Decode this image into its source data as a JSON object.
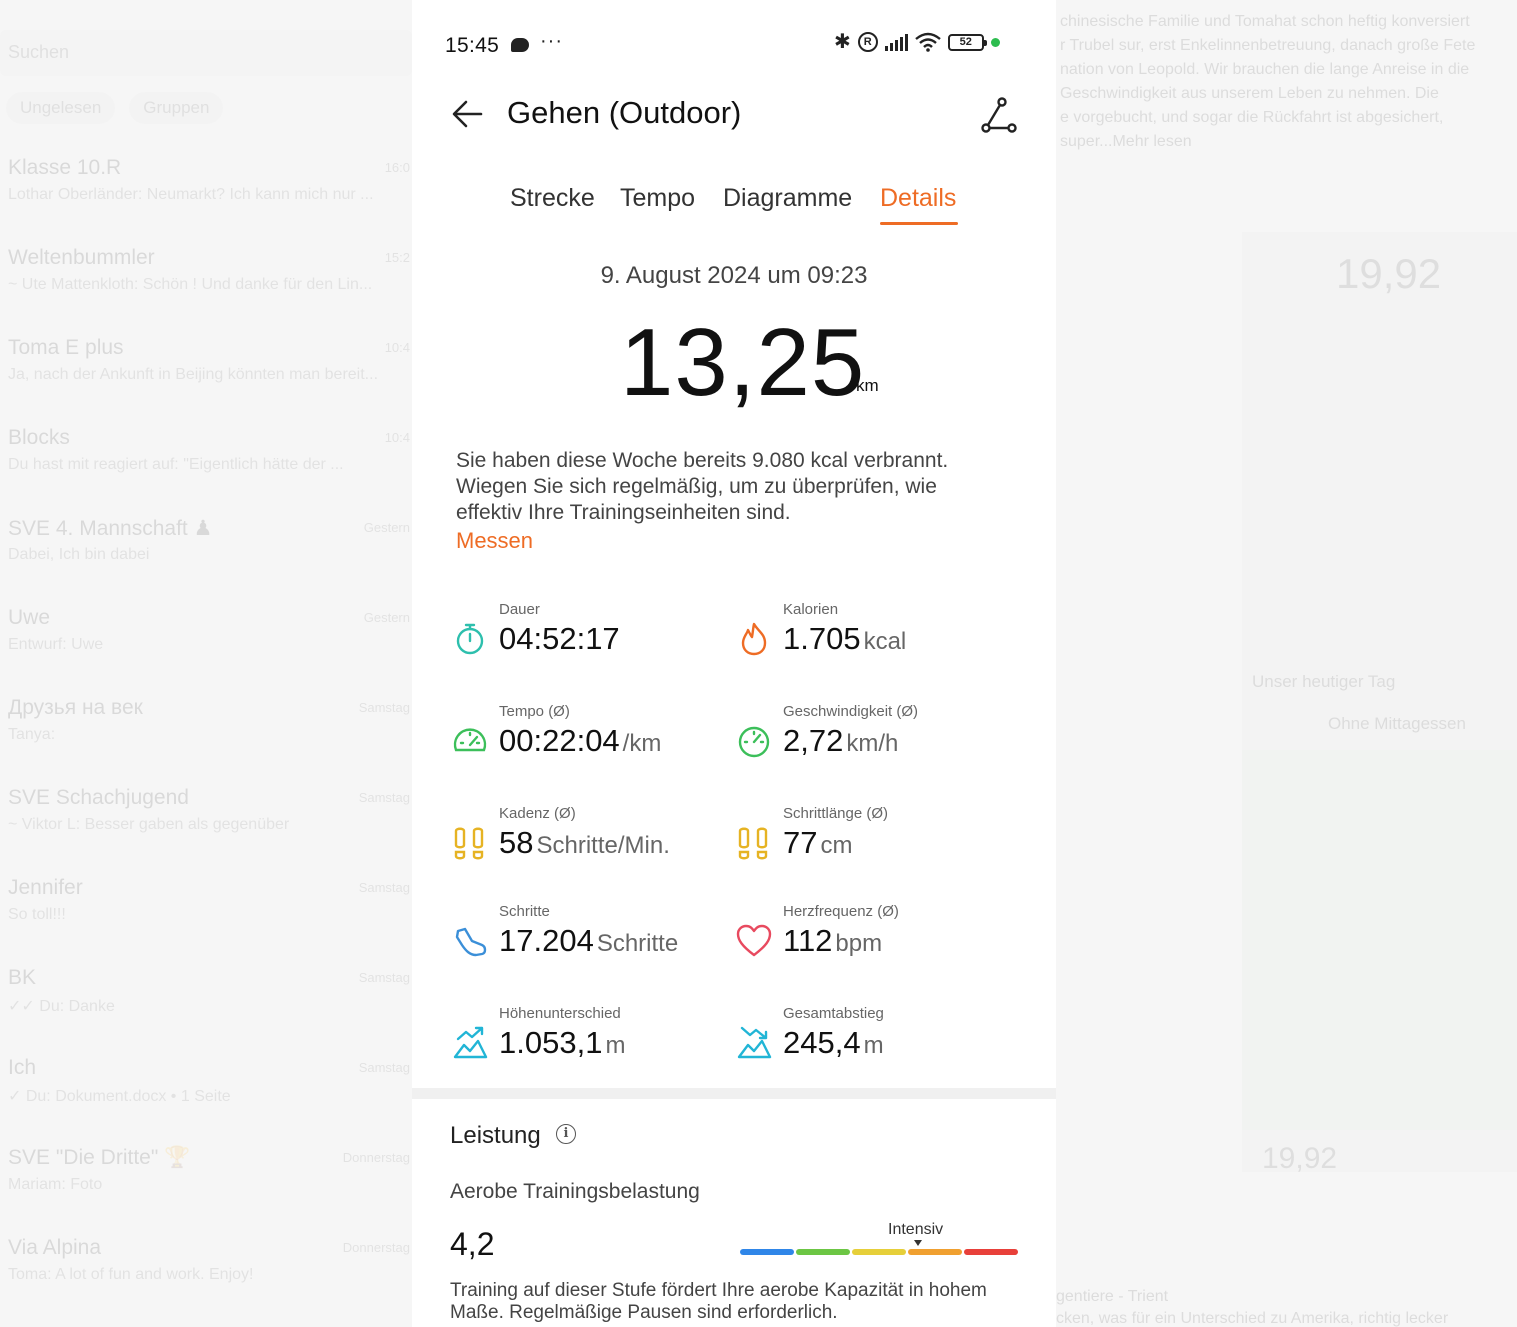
{
  "status_bar": {
    "time": "15:45",
    "dots": "···",
    "battery": "52",
    "icons": [
      "message-icon",
      "bluetooth-icon",
      "registered-icon",
      "signal-icon",
      "wifi-icon",
      "battery-icon",
      "status-dot"
    ]
  },
  "header": {
    "title": "Gehen (Outdoor)",
    "back_icon": "arrow-left-icon",
    "route_icon": "route-icon"
  },
  "tabs": [
    {
      "label": "Strecke",
      "active": false
    },
    {
      "label": "Tempo",
      "active": false
    },
    {
      "label": "Diagramme",
      "active": false
    },
    {
      "label": "Details",
      "active": true
    }
  ],
  "summary": {
    "date": "9. August 2024 um 09:23",
    "distance": "13,25",
    "distance_unit": "km",
    "info_line1": "Sie haben diese Woche bereits 9.080 kcal verbrannt.",
    "info_line2": "Wiegen Sie sich regelmäßig, um zu überprüfen, wie",
    "info_line3": "effektiv Ihre Trainingseinheiten sind.",
    "measure_link": "Messen"
  },
  "metrics": [
    {
      "label": "Dauer",
      "value": "04:52:17",
      "unit": "",
      "icon": "stopwatch-icon"
    },
    {
      "label": "Kalorien",
      "value": "1.705",
      "unit": "kcal",
      "icon": "flame-icon"
    },
    {
      "label": "Tempo (Ø)",
      "value": "00:22:04",
      "unit": "/km",
      "icon": "speedometer-icon"
    },
    {
      "label": "Geschwindigkeit (Ø)",
      "value": "2,72",
      "unit": "km/h",
      "icon": "gauge-icon"
    },
    {
      "label": "Kadenz (Ø)",
      "value": "58",
      "unit": "Schritte/Min.",
      "icon": "footprints-icon"
    },
    {
      "label": "Schrittlänge (Ø)",
      "value": "77",
      "unit": "cm",
      "icon": "footprints-icon"
    },
    {
      "label": "Schritte",
      "value": "17.204",
      "unit": "Schritte",
      "icon": "shoe-icon"
    },
    {
      "label": "Herzfrequenz (Ø)",
      "value": "112",
      "unit": "bpm",
      "icon": "heart-icon"
    },
    {
      "label": "Höhenunterschied",
      "value": "1.053,1",
      "unit": "m",
      "icon": "elevation-up-icon"
    },
    {
      "label": "Gesamtabstieg",
      "value": "245,4",
      "unit": "m",
      "icon": "elevation-down-icon"
    }
  ],
  "performance": {
    "title": "Leistung",
    "info_icon": "info-icon",
    "aerobe_label": "Aerobe Trainingsbelastung",
    "aerobe_value": "4,2",
    "intensity_label": "Intensiv",
    "scale_colors": [
      "#2f86e8",
      "#6cc644",
      "#e6cf3a",
      "#f0a030",
      "#e8403a"
    ],
    "text_line1": "Training auf dieser Stufe fördert Ihre aerobe Kapazität in hohem",
    "text_line2": "Maße. Regelmäßige Pausen sind erforderlich."
  },
  "colors": {
    "accent": "#ee6c25",
    "teal": "#2dbfad",
    "green": "#3cbf5a",
    "yellow": "#e6b323",
    "blue": "#3b8fd8",
    "red": "#e84a5f",
    "cyan": "#21b5d6"
  },
  "background_left": {
    "search": "Suchen",
    "chips": [
      "Ungelesen",
      "Gruppen"
    ],
    "chats": [
      {
        "name": "Klasse 10.R",
        "time": "16:0",
        "preview": "Lothar Oberländer: Neumarkt? Ich kann mich nur ..."
      },
      {
        "name": "Weltenbummler",
        "time": "15:2",
        "preview": "~ Ute Mattenkloth: Schön ! Und danke für den Lin..."
      },
      {
        "name": "Toma E plus",
        "time": "10:4",
        "preview": "Ja, nach der Ankunft in Beijing könnten man bereit..."
      },
      {
        "name": "Blocks",
        "time": "10:4",
        "preview": "Du hast mit reagiert auf: \"Eigentlich hätte der ..."
      },
      {
        "name": "SVE 4. Mannschaft ♟",
        "time": "Gestern",
        "preview": "Dabei, Ich bin dabei"
      },
      {
        "name": "Uwe",
        "time": "Gestern",
        "preview": "Entwurf: Uwe"
      },
      {
        "name": "Друзья на век",
        "time": "Samstag",
        "preview": "Tanya:"
      },
      {
        "name": "SVE Schachjugend",
        "time": "Samstag",
        "preview": "~ Viktor L: Besser gaben als gegenüber"
      },
      {
        "name": "Jennifer",
        "time": "Samstag",
        "preview": "So toll!!!"
      },
      {
        "name": "BK",
        "time": "Samstag",
        "preview": "✓✓ Du: Danke"
      },
      {
        "name": "Ich",
        "time": "Samstag",
        "preview": "✓ Du: Dokument.docx • 1 Seite"
      },
      {
        "name": "SVE \"Die Dritte\" 🏆",
        "time": "Donnerstag",
        "preview": "Mariam: Foto"
      },
      {
        "name": "Via Alpina",
        "time": "Donnerstag",
        "preview": "Toma: A lot of fun and work. Enjoy!"
      }
    ]
  },
  "background_right": {
    "message_lines": [
      "chinesische Familie und Tomahat schon heftig konversiert",
      "r Trubel sur, erst Enkelinnenbetreuung, danach große Fete",
      "nation von Leopold. Wir brauchen die lange Anreise in die",
      "Geschwindigkeit aus unserem Leben zu nehmen. Die",
      "e vorgebucht, und sogar die Rückfahrt ist abgesichert,",
      "super...Mehr lesen"
    ],
    "big_value": "19,92",
    "caption_1": "Unser heutiger Tag",
    "caption_2": "Ohne Mittagessen",
    "bottom_value": "19,92",
    "bottom_lines": [
      "gentiere - Trient",
      "cken, was für ein Unterschied zu Amerika, richtig lecker"
    ]
  }
}
